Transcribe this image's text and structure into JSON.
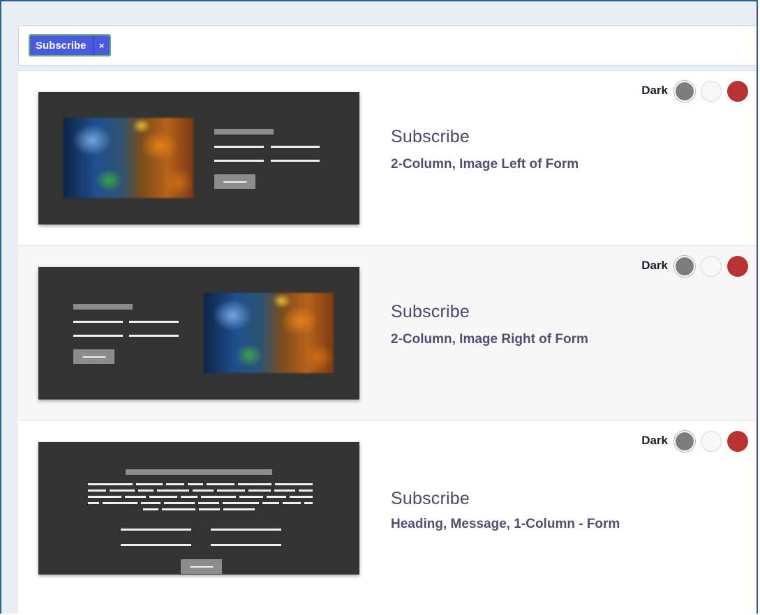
{
  "filter": {
    "tag_label": "Subscribe",
    "tag_remove": "×"
  },
  "templates": [
    {
      "title": "Subscribe",
      "subtitle": "2-Column, Image Left of Form",
      "variant": "Dark",
      "swatches": [
        "#7d7d7d",
        "#f8f8f8",
        "#b83232"
      ]
    },
    {
      "title": "Subscribe",
      "subtitle": "2-Column, Image Right of Form",
      "variant": "Dark",
      "swatches": [
        "#7d7d7d",
        "#f8f8f8",
        "#b83232"
      ]
    },
    {
      "title": "Subscribe",
      "subtitle": "Heading, Message, 1-Column - Form",
      "variant": "Dark",
      "swatches": [
        "#7d7d7d",
        "#f8f8f8",
        "#b83232"
      ]
    }
  ]
}
